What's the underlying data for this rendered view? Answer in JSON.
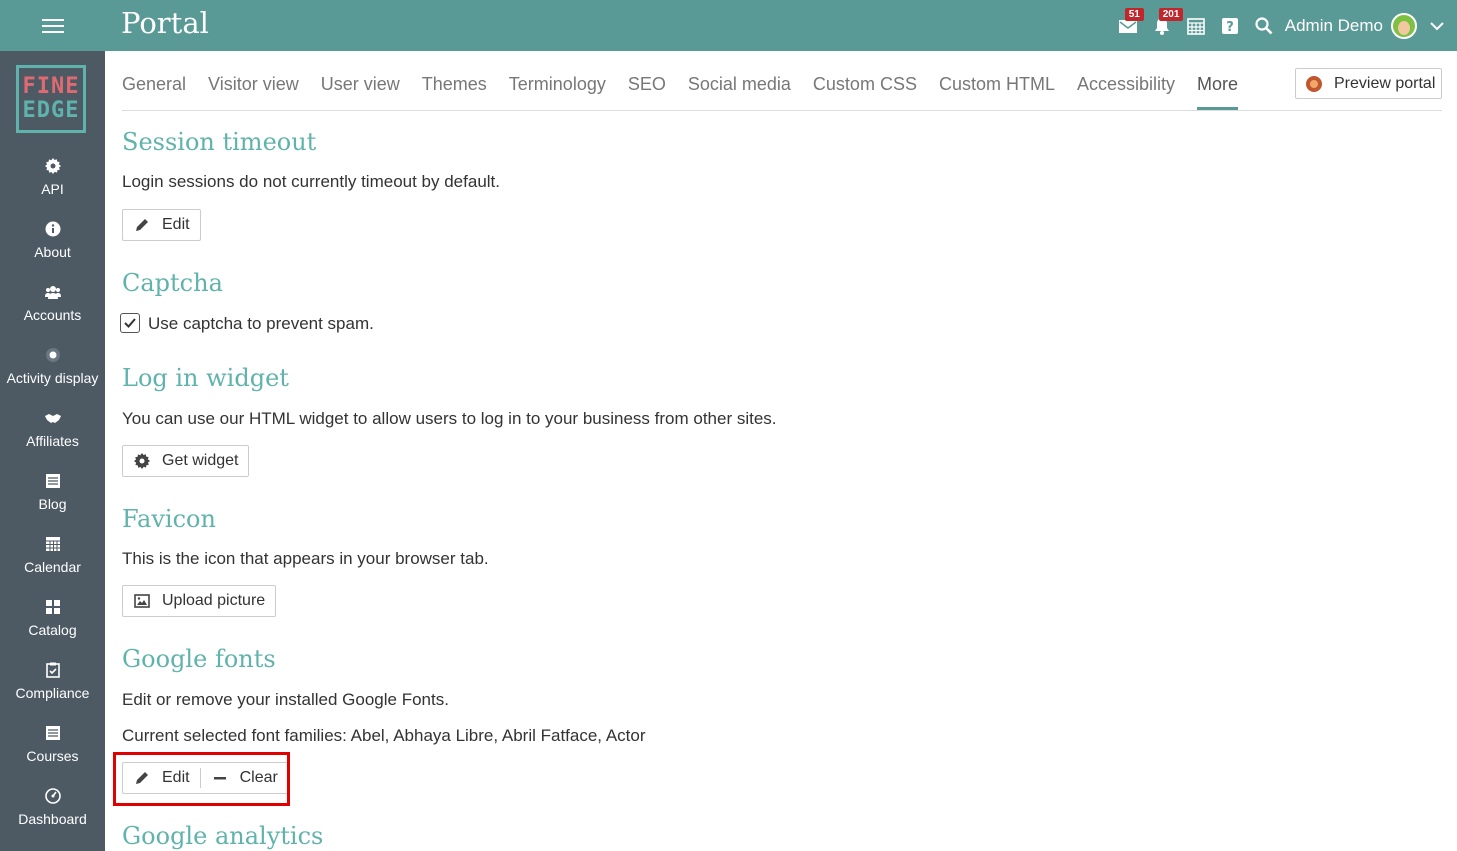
{
  "app": {
    "title": "Portal",
    "user_name": "Admin Demo",
    "mail_badge": "51",
    "notif_badge": "201"
  },
  "sidebar": {
    "logo_top": "FINE",
    "logo_bottom": "EDGE",
    "items": [
      {
        "label": "API",
        "icon": "gear-icon"
      },
      {
        "label": "About",
        "icon": "info-icon"
      },
      {
        "label": "Accounts",
        "icon": "users-icon"
      },
      {
        "label": "Activity display",
        "icon": "dot-icon"
      },
      {
        "label": "Affiliates",
        "icon": "handshake-icon"
      },
      {
        "label": "Blog",
        "icon": "blog-icon"
      },
      {
        "label": "Calendar",
        "icon": "calendar-icon"
      },
      {
        "label": "Catalog",
        "icon": "grid-icon"
      },
      {
        "label": "Compliance",
        "icon": "checklist-icon"
      },
      {
        "label": "Courses",
        "icon": "courses-icon"
      },
      {
        "label": "Dashboard",
        "icon": "dashboard-icon"
      }
    ]
  },
  "tabs": [
    {
      "label": "General"
    },
    {
      "label": "Visitor view"
    },
    {
      "label": "User view"
    },
    {
      "label": "Themes"
    },
    {
      "label": "Terminology"
    },
    {
      "label": "SEO"
    },
    {
      "label": "Social media"
    },
    {
      "label": "Custom CSS"
    },
    {
      "label": "Custom HTML"
    },
    {
      "label": "Accessibility"
    },
    {
      "label": "More"
    }
  ],
  "active_tab": "More",
  "preview_button": "Preview portal",
  "sections": {
    "session": {
      "title": "Session timeout",
      "text": "Login sessions do not currently timeout by default.",
      "button": "Edit"
    },
    "captcha": {
      "title": "Captcha",
      "checkbox_label": "Use captcha to prevent spam.",
      "checked": true
    },
    "login_widget": {
      "title": "Log in widget",
      "text": "You can use our HTML widget to allow users to log in to your business from other sites.",
      "button": "Get widget"
    },
    "favicon": {
      "title": "Favicon",
      "text": "This is the icon that appears in your browser tab.",
      "button": "Upload picture"
    },
    "google_fonts": {
      "title": "Google fonts",
      "text": "Edit or remove your installed Google Fonts.",
      "current": "Current selected font families: Abel, Abhaya Libre, Abril Fatface, Actor",
      "edit_button": "Edit",
      "clear_button": "Clear"
    },
    "google_analytics": {
      "title": "Google analytics"
    }
  },
  "colors": {
    "topbar": "#5a9a96",
    "sidebar": "#4d5a64",
    "heading": "#5fb3ac",
    "badge": "#c0262b",
    "highlight": "#e00000"
  }
}
